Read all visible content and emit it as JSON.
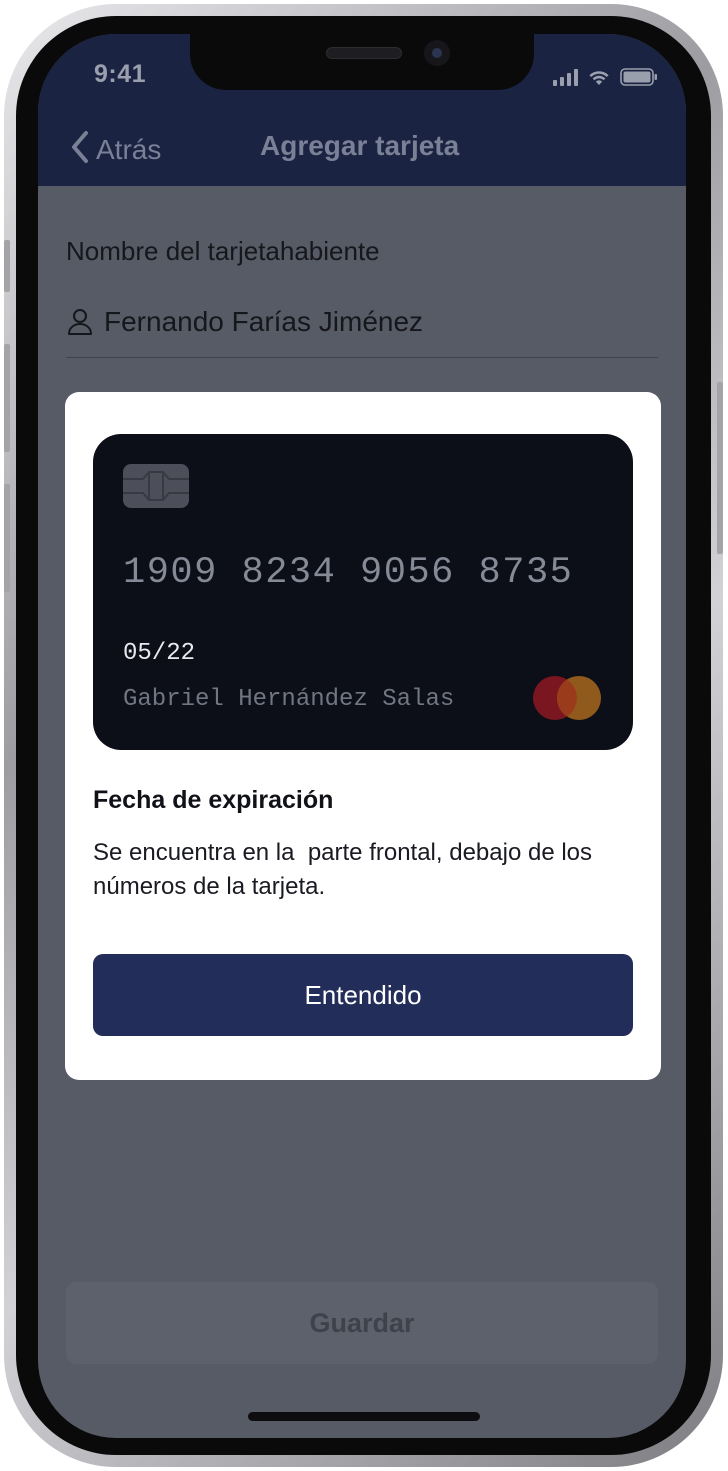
{
  "status_bar": {
    "time": "9:41",
    "signal_icon": "cellular-signal-icon",
    "wifi_icon": "wifi-icon",
    "battery_icon": "battery-icon"
  },
  "nav": {
    "back_icon": "chevron-left-icon",
    "back_label": "Atrás",
    "title": "Agregar tarjeta"
  },
  "form": {
    "cardholder_label": "Nombre del tarjetahabiente",
    "cardholder_icon": "user-icon",
    "cardholder_value": "Fernando Farías Jiménez",
    "save_label": "Guardar"
  },
  "modal": {
    "card": {
      "number": "1909 8234 9056 8735",
      "expiry": "05/22",
      "holder": "Gabriel Hernández Salas",
      "chip_icon": "card-chip-icon",
      "brand_icon": "mastercard-logo"
    },
    "title": "Fecha de expiración",
    "description": "Se encuentra en la  parte frontal, debajo de los números de la tarjeta.",
    "button_label": "Entendido"
  },
  "colors": {
    "nav_background": "#1a2341",
    "overlay_background": "#575b66",
    "primary_button": "#222d5a",
    "card_background": "#0c0e18"
  }
}
